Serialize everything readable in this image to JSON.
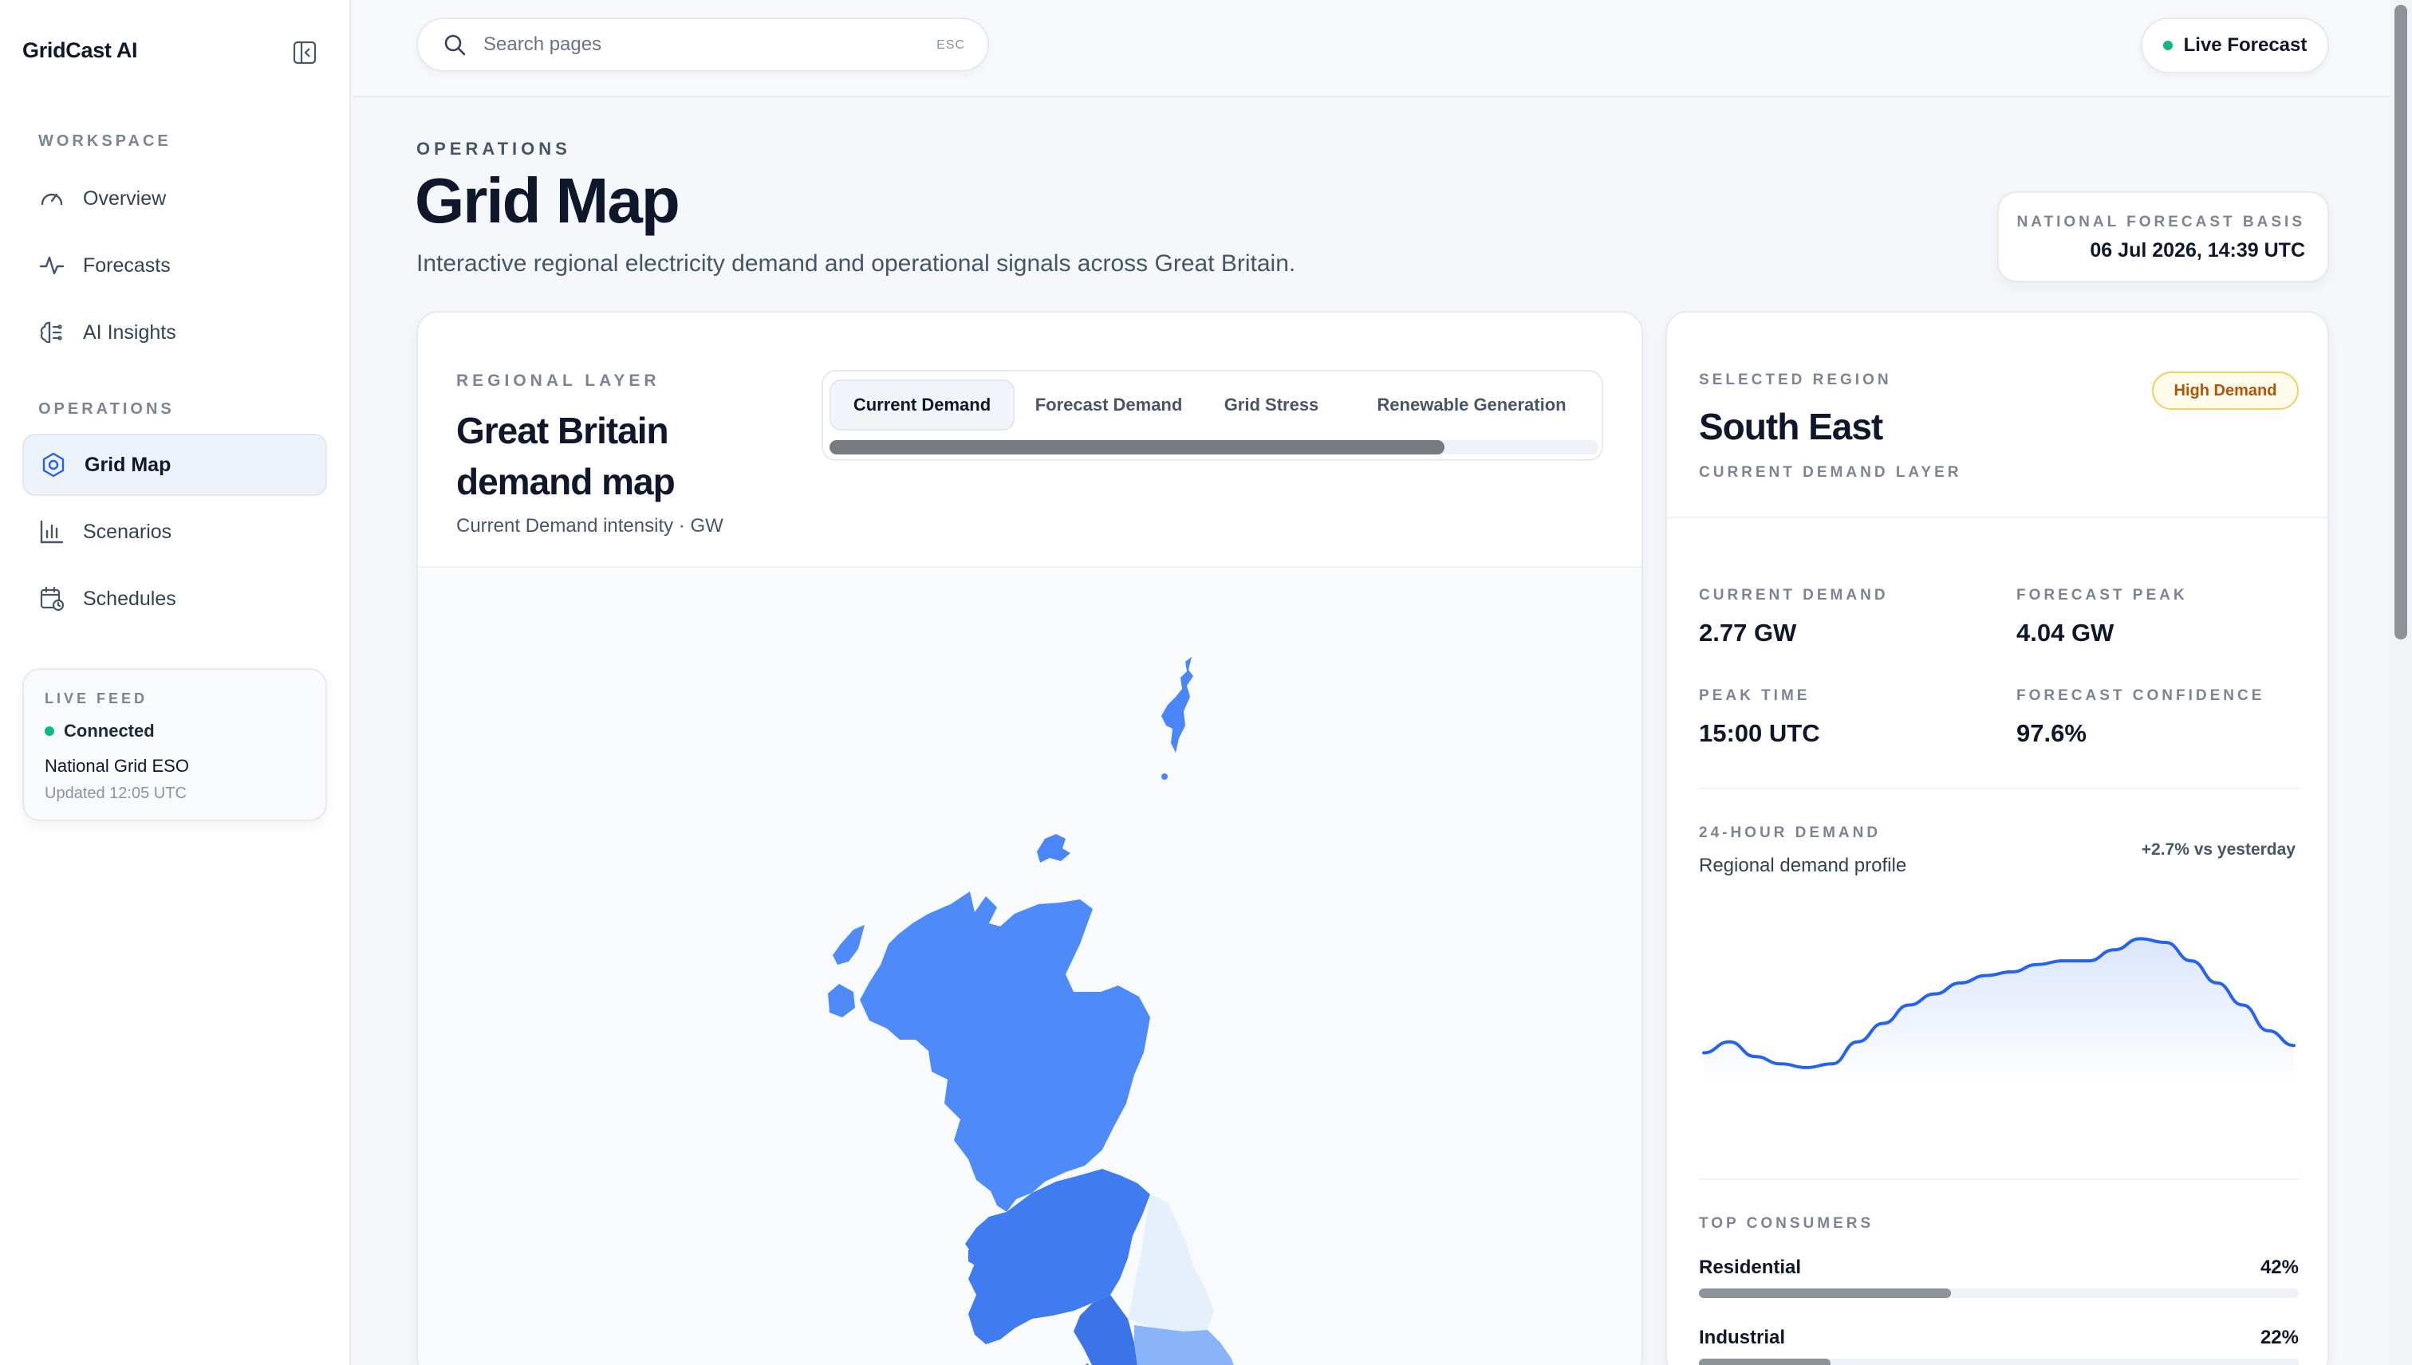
{
  "app": {
    "brand": "GridCast AI"
  },
  "sidebar": {
    "sections": [
      {
        "label": "WORKSPACE",
        "items": [
          {
            "label": "Overview",
            "icon": "gauge-icon"
          },
          {
            "label": "Forecasts",
            "icon": "activity-icon"
          },
          {
            "label": "AI Insights",
            "icon": "brain-icon"
          }
        ]
      },
      {
        "label": "OPERATIONS",
        "items": [
          {
            "label": "Grid Map",
            "icon": "hexagon-target-icon",
            "active": true
          },
          {
            "label": "Scenarios",
            "icon": "bar-chart-icon"
          },
          {
            "label": "Schedules",
            "icon": "calendar-clock-icon"
          }
        ]
      }
    ],
    "live_feed": {
      "title": "LIVE FEED",
      "status": "Connected",
      "source": "National Grid ESO",
      "updated": "Updated 12:05 UTC"
    }
  },
  "topbar": {
    "search_placeholder": "Search pages",
    "search_hint": "ESC",
    "live_button": "Live Forecast"
  },
  "header": {
    "eyebrow": "OPERATIONS",
    "title": "Grid Map",
    "subtitle": "Interactive regional electricity demand and operational signals across Great Britain.",
    "basis_label": "NATIONAL FORECAST BASIS",
    "basis_value": "06 Jul 2026, 14:39 UTC"
  },
  "map_card": {
    "eyebrow": "REGIONAL LAYER",
    "title": "Great Britain demand map",
    "subtitle": "Current Demand intensity · GW",
    "tabs": [
      "Current Demand",
      "Forecast Demand",
      "Grid Stress",
      "Renewable Generation"
    ],
    "active_tab": 0,
    "tab_scroll_fraction": 0.8
  },
  "region_panel": {
    "eyebrow": "SELECTED REGION",
    "name": "South East",
    "layer": "CURRENT DEMAND LAYER",
    "badge": "High Demand",
    "metrics": [
      {
        "label": "CURRENT DEMAND",
        "value": "2.77 GW"
      },
      {
        "label": "FORECAST PEAK",
        "value": "4.04 GW"
      },
      {
        "label": "PEAK TIME",
        "value": "15:00 UTC"
      },
      {
        "label": "FORECAST CONFIDENCE",
        "value": "97.6%"
      }
    ],
    "chart_title": "24-HOUR DEMAND",
    "chart_subtitle": "Regional demand profile",
    "chart_delta": "+2.7% vs yesterday",
    "consumers_title": "TOP CONSUMERS",
    "consumers": [
      {
        "name": "Residential",
        "pct_label": "42%",
        "pct": 42
      },
      {
        "name": "Industrial",
        "pct_label": "22%",
        "pct": 22
      }
    ]
  },
  "chart_data": {
    "type": "area",
    "x": [
      0,
      1,
      2,
      3,
      4,
      5,
      6,
      7,
      8,
      9,
      10,
      11,
      12,
      13,
      14,
      15,
      16,
      17,
      18,
      19,
      20,
      21,
      22,
      23
    ],
    "series": [
      {
        "values": [
          0.52,
          0.55,
          0.51,
          0.49,
          0.48,
          0.49,
          0.55,
          0.6,
          0.65,
          0.68,
          0.71,
          0.73,
          0.74,
          0.76,
          0.77,
          0.77,
          0.8,
          0.83,
          0.82,
          0.77,
          0.71,
          0.65,
          0.58,
          0.54
        ]
      }
    ],
    "ylim": [
      0.3,
      0.95
    ],
    "grid": false,
    "colors": {
      "line": "#2563eb",
      "fill_top": "#dbe5fb",
      "fill_bottom": "#ffffff"
    }
  },
  "colors": {
    "accent": "#2563eb",
    "status_green": "#10b981",
    "map_high": "#4a86f7",
    "map_mid": "#3d79ec",
    "map_low": "#8ab4f9",
    "map_pale": "#e6effc"
  }
}
